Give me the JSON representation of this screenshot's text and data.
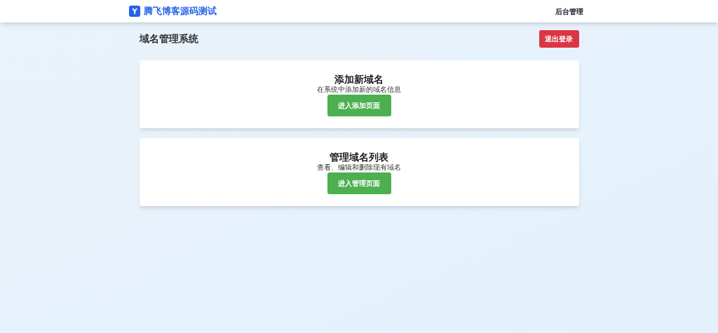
{
  "header": {
    "logo": "Y",
    "site_title": "腾飞博客源码测试",
    "nav_link": "后台管理"
  },
  "page_title": "域名管理系统",
  "logout_button": "退出登录",
  "cards": [
    {
      "title": "添加新域名",
      "description": "在系统中添加新的域名信息",
      "button": "进入添加页面"
    },
    {
      "title": "管理域名列表",
      "description": "查看、编辑和删除现有域名",
      "button": "进入管理页面"
    }
  ]
}
